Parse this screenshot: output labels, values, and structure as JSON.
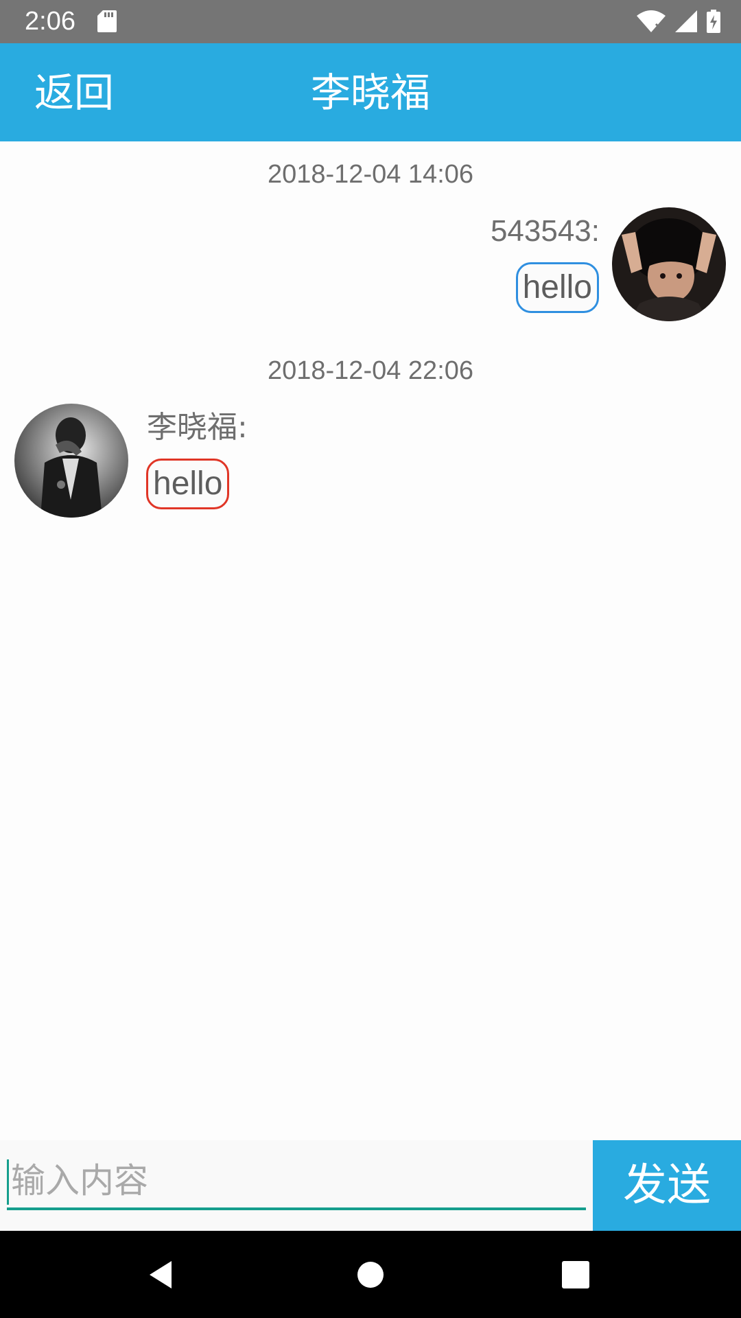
{
  "status_bar": {
    "time": "2:06",
    "icons": [
      "sd-card-icon",
      "wifi-icon",
      "signal-icon",
      "battery-icon"
    ]
  },
  "header": {
    "back_label": "返回",
    "title": "李晓福",
    "color": "#29abe0"
  },
  "messages": [
    {
      "timestamp": "2018-12-04 14:06",
      "direction": "outgoing",
      "sender": "543543:",
      "text": "hello",
      "bubble_color": "#2f8fe0"
    },
    {
      "timestamp": "2018-12-04 22:06",
      "direction": "incoming",
      "sender": "李晓福:",
      "text": "hello",
      "bubble_color": "#e03526"
    }
  ],
  "composer": {
    "placeholder": "输入内容",
    "value": "",
    "send_label": "发送",
    "accent": "#159e8d"
  },
  "nav_bar": {
    "icons": [
      "back-icon",
      "home-icon",
      "recents-icon"
    ]
  }
}
